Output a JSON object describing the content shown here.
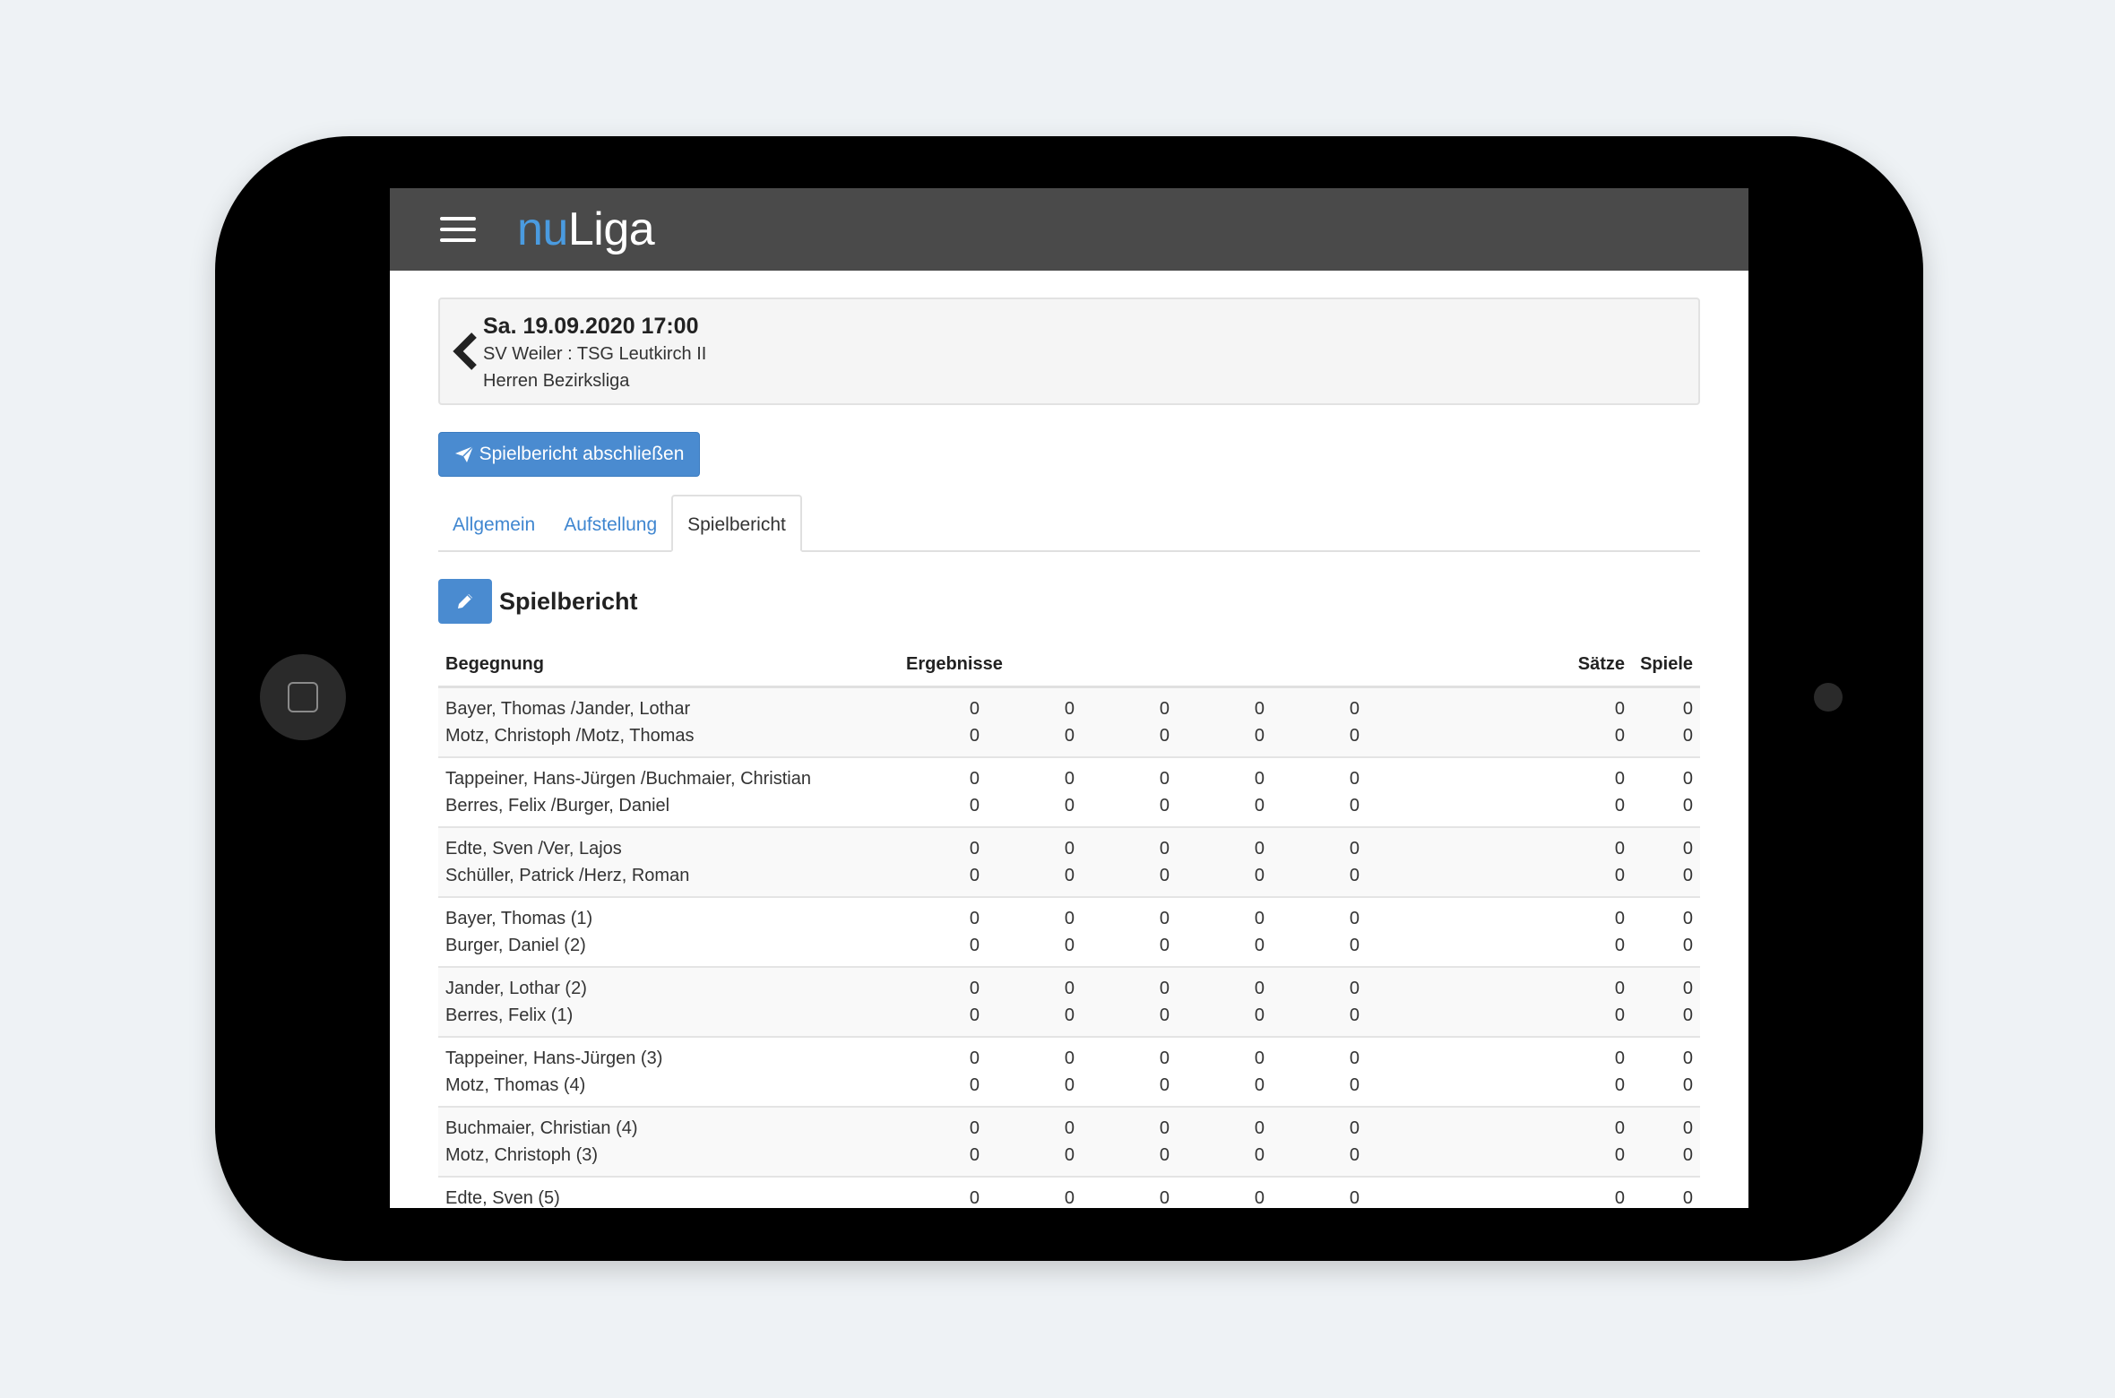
{
  "app": {
    "brand_nu": "nu",
    "brand_liga": "Liga"
  },
  "header": {
    "date": "Sa. 19.09.2020 17:00",
    "teams": "SV Weiler : TSG Leutkirch II",
    "league": "Herren Bezirksliga"
  },
  "actions": {
    "finish_label": "Spielbericht abschließen"
  },
  "tabs": [
    {
      "label": "Allgemein"
    },
    {
      "label": "Aufstellung"
    },
    {
      "label": "Spielbericht"
    }
  ],
  "section": {
    "title": "Spielbericht"
  },
  "table": {
    "headers": {
      "match": "Begegnung",
      "results": "Ergebnisse",
      "sets": "Sätze",
      "games": "Spiele"
    },
    "rows": [
      {
        "p1": "Bayer, Thomas /Jander, Lothar",
        "p2": "Motz, Christoph /Motz, Thomas",
        "r1": [
          "0",
          "0",
          "0",
          "0",
          "0"
        ],
        "r2": [
          "0",
          "0",
          "0",
          "0",
          "0"
        ],
        "s1": "0",
        "s2": "0",
        "g1": "0",
        "g2": "0"
      },
      {
        "p1": "Tappeiner, Hans-Jürgen /Buchmaier, Christian",
        "p2": "Berres, Felix /Burger, Daniel",
        "r1": [
          "0",
          "0",
          "0",
          "0",
          "0"
        ],
        "r2": [
          "0",
          "0",
          "0",
          "0",
          "0"
        ],
        "s1": "0",
        "s2": "0",
        "g1": "0",
        "g2": "0"
      },
      {
        "p1": "Edte, Sven /Ver, Lajos",
        "p2": "Schüller, Patrick /Herz, Roman",
        "r1": [
          "0",
          "0",
          "0",
          "0",
          "0"
        ],
        "r2": [
          "0",
          "0",
          "0",
          "0",
          "0"
        ],
        "s1": "0",
        "s2": "0",
        "g1": "0",
        "g2": "0"
      },
      {
        "p1": "Bayer, Thomas (1)",
        "p2": "Burger, Daniel (2)",
        "r1": [
          "0",
          "0",
          "0",
          "0",
          "0"
        ],
        "r2": [
          "0",
          "0",
          "0",
          "0",
          "0"
        ],
        "s1": "0",
        "s2": "0",
        "g1": "0",
        "g2": "0"
      },
      {
        "p1": "Jander, Lothar (2)",
        "p2": "Berres, Felix (1)",
        "r1": [
          "0",
          "0",
          "0",
          "0",
          "0"
        ],
        "r2": [
          "0",
          "0",
          "0",
          "0",
          "0"
        ],
        "s1": "0",
        "s2": "0",
        "g1": "0",
        "g2": "0"
      },
      {
        "p1": "Tappeiner, Hans-Jürgen (3)",
        "p2": "Motz, Thomas (4)",
        "r1": [
          "0",
          "0",
          "0",
          "0",
          "0"
        ],
        "r2": [
          "0",
          "0",
          "0",
          "0",
          "0"
        ],
        "s1": "0",
        "s2": "0",
        "g1": "0",
        "g2": "0"
      },
      {
        "p1": "Buchmaier, Christian (4)",
        "p2": "Motz, Christoph (3)",
        "r1": [
          "0",
          "0",
          "0",
          "0",
          "0"
        ],
        "r2": [
          "0",
          "0",
          "0",
          "0",
          "0"
        ],
        "s1": "0",
        "s2": "0",
        "g1": "0",
        "g2": "0"
      },
      {
        "p1": "Edte, Sven (5)",
        "p2": "",
        "r1": [
          "0",
          "0",
          "0",
          "0",
          "0"
        ],
        "r2": [
          "",
          "",
          "",
          "",
          ""
        ],
        "s1": "0",
        "s2": "",
        "g1": "0",
        "g2": ""
      }
    ]
  }
}
